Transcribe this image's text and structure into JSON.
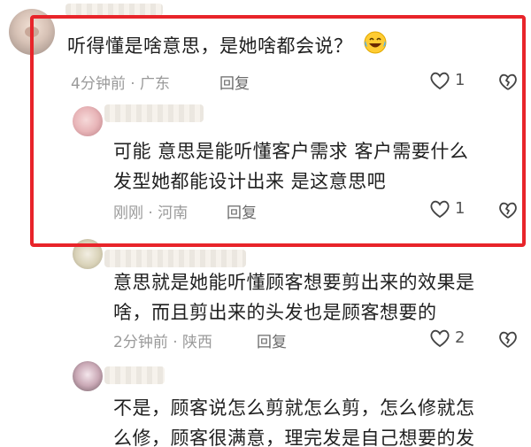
{
  "comments": [
    {
      "text": "听得懂是啥意思，是她啥都会说？",
      "emoji_icon": "laughing-tears-icon",
      "time_location": "4分钟前 · 广东",
      "reply_label": "回复",
      "likes": "1"
    },
    {
      "text_line1": "可能 意思是能听懂客户需求 客户需要什么",
      "text_line2": "发型她都能设计出来 是这意思吧",
      "time_location": "刚刚 · 河南",
      "reply_label": "回复",
      "likes": "1"
    },
    {
      "text_line1": "意思就是她能听懂顾客想要剪出来的效果是",
      "text_line2": "啥，而且剪出来的头发也是顾客想要的",
      "time_location": "2分钟前 · 陕西",
      "reply_label": "回复",
      "likes": "2"
    },
    {
      "text_line1": "不是，顾客说怎么剪就怎么剪，怎么修就怎",
      "text_line2": "么修，顾客很满意，理完发是自己想要的发"
    }
  ],
  "colors": {
    "highlight": "#e8242a",
    "meta": "#9a9a9a"
  }
}
